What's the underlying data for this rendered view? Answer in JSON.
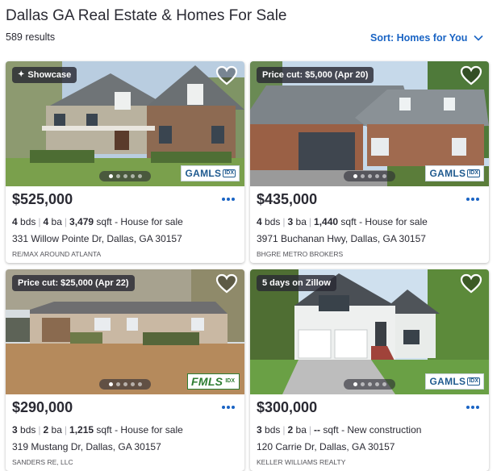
{
  "header": {
    "title": "Dallas GA Real Estate & Homes For Sale",
    "results": "589 results",
    "sort_label": "Sort: Homes for You"
  },
  "colors": {
    "accent": "#1a64c4",
    "text": "#2a2a33",
    "tag_bg": "#2a2a33"
  },
  "listings": [
    {
      "tag": "Showcase",
      "tag_icon": "sparkle-icon",
      "price": "$525,000",
      "beds": "4",
      "beds_unit": "bds",
      "baths": "4",
      "baths_unit": "ba",
      "sqft": "3,479",
      "sqft_unit": "sqft",
      "type": "- House for sale",
      "address": "331 Willow Pointe Dr, Dallas, GA 30157",
      "broker": "RE/MAX AROUND ATLANTA",
      "mls_logo": "GAMLS",
      "mls_sup": "IDX"
    },
    {
      "tag": "Price cut: $5,000 (Apr 20)",
      "price": "$435,000",
      "beds": "4",
      "beds_unit": "bds",
      "baths": "3",
      "baths_unit": "ba",
      "sqft": "1,440",
      "sqft_unit": "sqft",
      "type": "- House for sale",
      "address": "3971 Buchanan Hwy, Dallas, GA 30157",
      "broker": "BHGRE METRO BROKERS",
      "mls_logo": "GAMLS",
      "mls_sup": "IDX"
    },
    {
      "tag": "Price cut: $25,000 (Apr 22)",
      "price": "$290,000",
      "beds": "3",
      "beds_unit": "bds",
      "baths": "2",
      "baths_unit": "ba",
      "sqft": "1,215",
      "sqft_unit": "sqft",
      "type": "- House for sale",
      "address": "319 Mustang Dr, Dallas, GA 30157",
      "broker": "SANDERS RE, LLC",
      "mls_logo": "FMLS",
      "mls_sup": "IDX"
    },
    {
      "tag": "5 days on Zillow",
      "price": "$300,000",
      "beds": "3",
      "beds_unit": "bds",
      "baths": "2",
      "baths_unit": "ba",
      "sqft": "--",
      "sqft_unit": "sqft",
      "type": "- New construction",
      "address": "120 Carrie Dr, Dallas, GA 30157",
      "broker": "KELLER WILLIAMS REALTY",
      "mls_logo": "GAMLS",
      "mls_sup": "IDX"
    }
  ]
}
